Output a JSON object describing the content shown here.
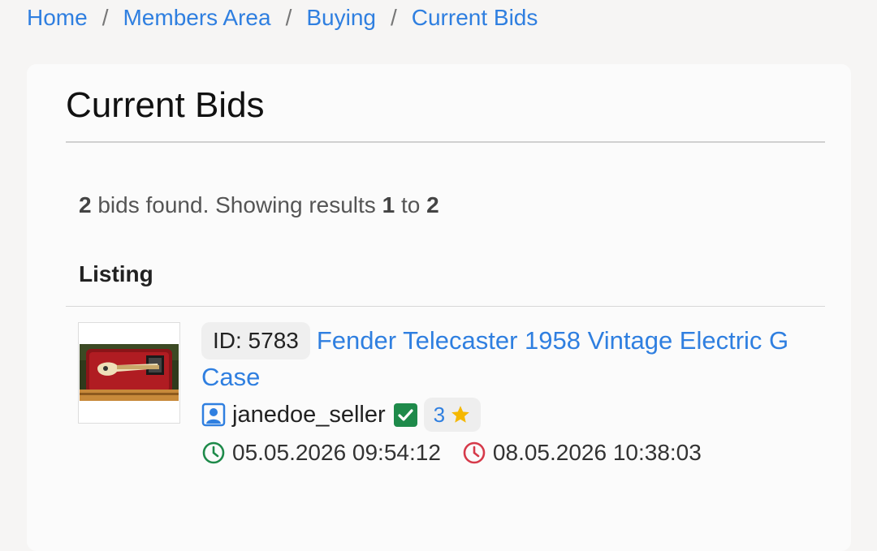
{
  "breadcrumb": {
    "items": [
      "Home",
      "Members Area",
      "Buying",
      "Current Bids"
    ],
    "separator": "/"
  },
  "page": {
    "title": "Current Bids"
  },
  "results": {
    "total": "2",
    "text_found": "bids found. Showing results",
    "from": "1",
    "to_word": "to",
    "to": "2"
  },
  "table": {
    "column_header": "Listing"
  },
  "listing": {
    "id_label": "ID: 5783",
    "title_line1": "Fender Telecaster 1958 Vintage Electric G",
    "title_line2": "Case",
    "seller": "janedoe_seller",
    "rating": "3",
    "start_date": "05.05.2026 09:54:12",
    "end_date": "08.05.2026 10:38:03",
    "icons": {
      "seller": "user-profile-icon",
      "verified": "check-square-icon",
      "rating": "star-icon",
      "start": "clock-green-icon",
      "end": "clock-red-icon"
    }
  },
  "colors": {
    "link": "#2f7fe0",
    "verified": "#1e8a4a",
    "start_clock": "#1e8a4a",
    "end_clock": "#d63a4a",
    "star": "#f5b800"
  }
}
